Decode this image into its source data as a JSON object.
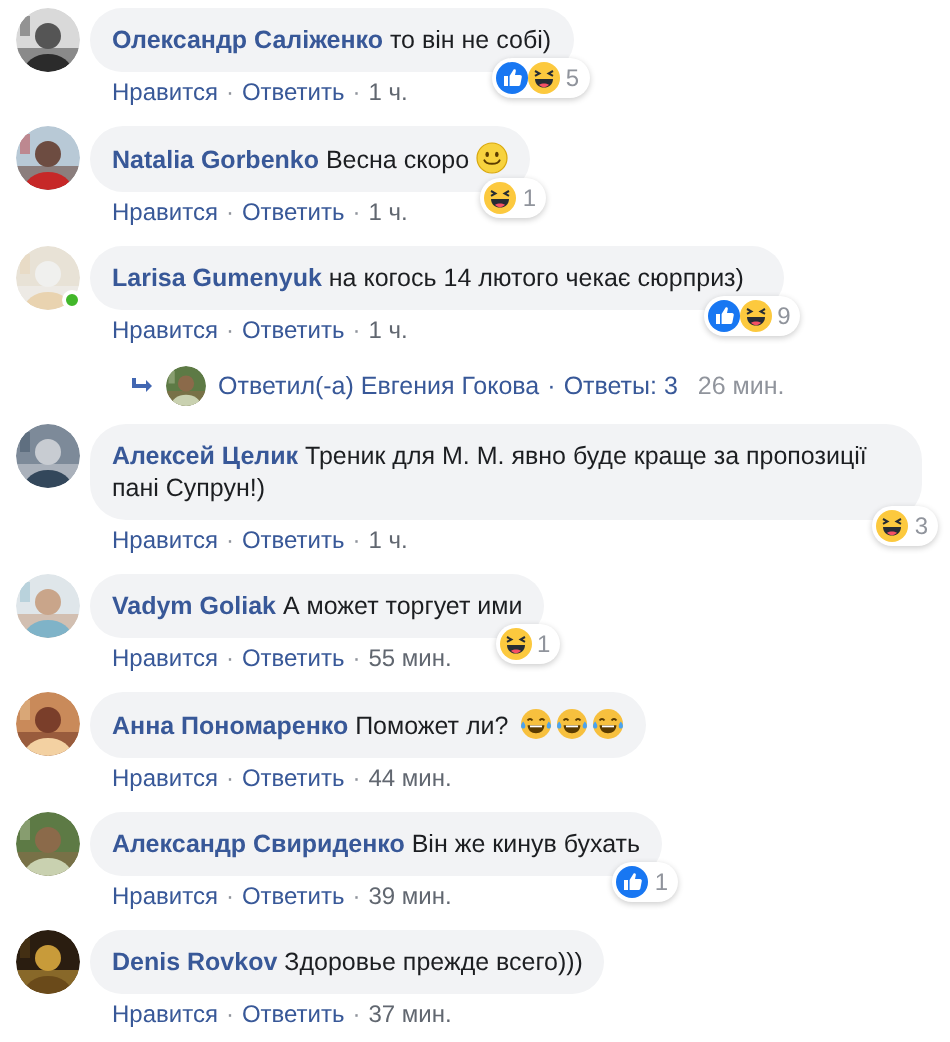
{
  "comments": [
    {
      "author": "Олександр Саліженко",
      "text": "то він не собі)",
      "online": false,
      "reactions": {
        "icons": [
          {
            "kind": "like"
          },
          {
            "kind": "haha"
          }
        ],
        "count": "5"
      },
      "actions": {
        "like": "Нравится",
        "separator": "·",
        "reply": "Ответить",
        "time": "1 ч."
      }
    },
    {
      "author": "Natalia Gorbenko",
      "text": "Весна скоро",
      "emoji": [
        {
          "kind": "smile"
        }
      ],
      "online": false,
      "reactions": {
        "icons": [
          {
            "kind": "haha"
          }
        ],
        "count": "1"
      },
      "actions": {
        "like": "Нравится",
        "separator": "·",
        "reply": "Ответить",
        "time": "1 ч."
      }
    },
    {
      "author": "Larisa Gumenyuk",
      "text": "на когось 14 лютого чекає сюрприз)",
      "online": true,
      "reactions": {
        "icons": [
          {
            "kind": "like"
          },
          {
            "kind": "haha"
          }
        ],
        "count": "9"
      },
      "actions": {
        "like": "Нравится",
        "separator": "·",
        "reply": "Ответить",
        "time": "1 ч."
      },
      "replies_summary": {
        "replied_by": "Ответил(-а) Евгения Гокова",
        "separator": "·",
        "replies": "Ответы: 3",
        "time": "26 мин."
      }
    },
    {
      "author": "Алексей Целик",
      "text": "Треник для М. М. явно буде краще за пропозиції пані Супрун!)",
      "online": false,
      "reactions": {
        "icons": [
          {
            "kind": "haha"
          }
        ],
        "count": "3"
      },
      "actions": {
        "like": "Нравится",
        "separator": "·",
        "reply": "Ответить",
        "time": "1 ч."
      }
    },
    {
      "author": "Vadym Goliak",
      "text": "А может торгует ими",
      "online": false,
      "reactions": {
        "icons": [
          {
            "kind": "haha"
          }
        ],
        "count": "1"
      },
      "actions": {
        "like": "Нравится",
        "separator": "·",
        "reply": "Ответить",
        "time": "55 мин."
      }
    },
    {
      "author": "Анна Пономаренко",
      "text": "Поможет ли?",
      "emoji": [
        {
          "kind": "laugh_cry"
        },
        {
          "kind": "laugh_cry"
        },
        {
          "kind": "laugh_cry"
        }
      ],
      "online": false,
      "actions": {
        "like": "Нравится",
        "separator": "·",
        "reply": "Ответить",
        "time": "44 мин."
      }
    },
    {
      "author": "Александр Свириденко",
      "text": "Він же кинув бухать",
      "online": false,
      "reactions": {
        "icons": [
          {
            "kind": "like"
          }
        ],
        "count": "1"
      },
      "actions": {
        "like": "Нравится",
        "separator": "·",
        "reply": "Ответить",
        "time": "39 мин."
      }
    },
    {
      "author": "Denis Rovkov",
      "text": "Здоровье прежде всего)))",
      "online": false,
      "actions": {
        "like": "Нравится",
        "separator": "·",
        "reply": "Ответить",
        "time": "37 мин."
      }
    }
  ]
}
